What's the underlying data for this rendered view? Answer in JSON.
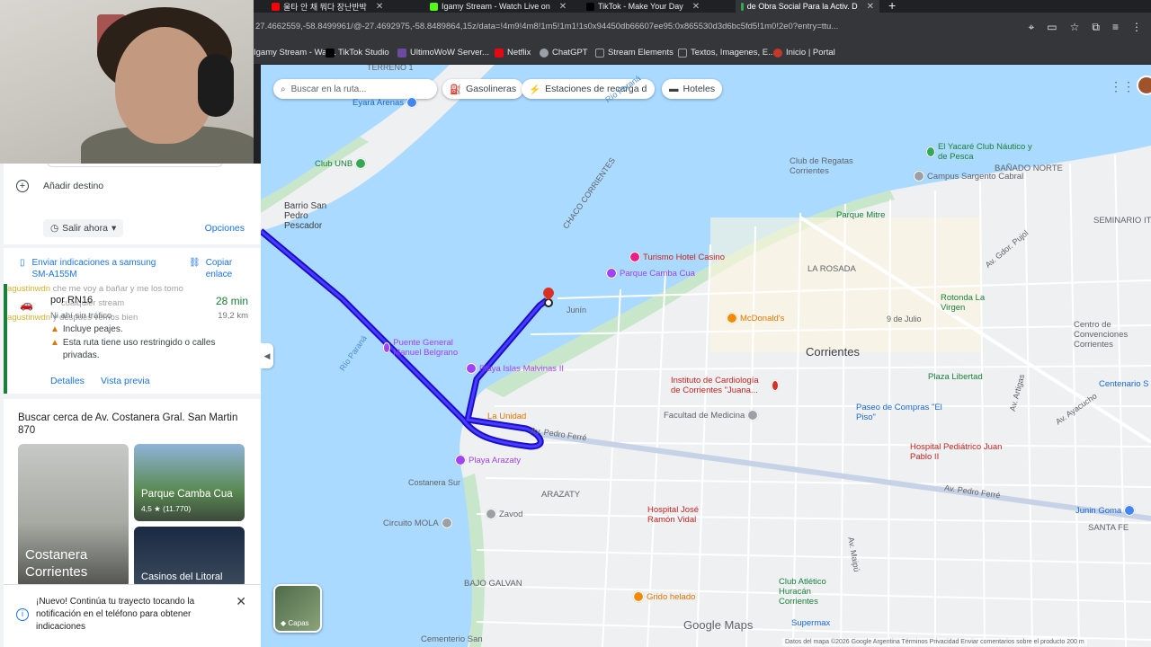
{
  "browser": {
    "tabs": [
      {
        "label": "울타 안 채 뭐다 장난반박",
        "color": "#ff0000"
      },
      {
        "label": "Igamy Stream - Watch Live on",
        "color": "#53fc18"
      },
      {
        "label": "TikTok - Make Your Day",
        "color": "#000000"
      },
      {
        "label": "de Obra Social Para la Activ. D",
        "color": "#34a853"
      }
    ],
    "url": "27.4662559,-58.8499961/@-27.4692975,-58.8489864,15z/data=!4m9!4m8!1m5!1m1!1s0x94450db66607ee95:0x865530d3d6bc5fd5!1m0!2e0?entry=ttu...",
    "bookmarks": [
      {
        "label": "Igamy Stream - Wat...",
        "color": "#53fc18"
      },
      {
        "label": "TikTok Studio",
        "color": "#000000"
      },
      {
        "label": "UltimoWoW Server...",
        "color": "#6b4aa0"
      },
      {
        "label": "Netflix",
        "color": "#e50914"
      },
      {
        "label": "ChatGPT",
        "color": "#9aa0a6"
      },
      {
        "label": "Stream Elements",
        "color": "#9aa0a6"
      },
      {
        "label": "Textos, Imagenes, E...",
        "color": "#9aa0a6"
      },
      {
        "label": "Inicio | Portal",
        "color": "#c0392b"
      }
    ]
  },
  "panel": {
    "add_destination": "Añadir destino",
    "depart": "Salir ahora",
    "options": "Opciones",
    "send": "Enviar indicaciones a samsung SM-A155M",
    "copy": "Copiar enlace",
    "route": {
      "via": "por RN16",
      "duration": "28 min",
      "traffic": "Ni ahí sin tráfico",
      "distance": "19,2 km",
      "warning1": "Incluye peajes.",
      "warning2": "Esta ruta tiene uso restringido o calles privadas.",
      "details": "Detalles",
      "preview": "Vista previa"
    },
    "chat": [
      {
        "user": "agustinwdn",
        "msg": "che me voy a bañar y me los tomo"
      },
      {
        "user": "",
        "msg": "cualquier stream"
      },
      {
        "user": "agustinwdn",
        "msg": "y después vemos bien"
      }
    ],
    "nearby_title": "Buscar cerca de Av. Costanera Gral. San Martin 870",
    "places": [
      {
        "name": "Costanera Corrientes"
      },
      {
        "name": "Parque Camba Cua",
        "rating": "4,5 ★ (11.770)"
      },
      {
        "name": "Casinos del Litoral"
      }
    ],
    "toast": "¡Nuevo! Continúa tu trayecto tocando la notificación en el teléfono para obtener indicaciones"
  },
  "map": {
    "search_placeholder": "Buscar en la ruta...",
    "chips": [
      "Gasolineras",
      "Estaciones de recarga d...",
      "Hoteles"
    ],
    "city": "Corrientes",
    "layers": "Capas",
    "logo": "Google Maps",
    "attribution": "Datos del mapa ©2026 Google   Argentina   Términos   Privacidad   Enviar comentarios sobre el producto   200 m",
    "labels": {
      "barrio": "Barrio San Pedro Pescador",
      "chaco": "CHACO CORRIENTES",
      "rio": "Río Paraná",
      "rio2": "Río Paraná",
      "la_rosada": "LA ROSADA",
      "banado": "BAÑADO NORTE",
      "seminario": "SEMINARIO ITA",
      "arazaty": "ARAZATY",
      "bajo_galvan": "BAJO GALVAN",
      "costanera_sur": "Costanera Sur",
      "terreno": "TERRENO 1",
      "lineas": "Av. Pedro Ferré",
      "av_ferre2": "Av. Pedro Ferré",
      "av_ayacucho": "Av. Ayacucho",
      "av_maipu": "Av. Maipú",
      "nueve_julio": "9 de Julio",
      "junin": "Junín",
      "santa_fe": "SANTA FE",
      "av_artigas": "Av. Artigas",
      "av_gdor": "Av. Gdor. Pujol"
    },
    "pois": [
      {
        "name": "Eyará Arenas",
        "color": "#4285f4"
      },
      {
        "name": "Club de Regatas Corrientes",
        "color": "#9aa0a6"
      },
      {
        "name": "El Yacaré Club Náutico y de Pesca",
        "color": "#34a853"
      },
      {
        "name": "Campus Sargento Cabral",
        "color": "#9aa0a6"
      },
      {
        "name": "Parque Mitre",
        "color": "#34a853"
      },
      {
        "name": "Turismo Hotel Casino",
        "color": "#e91e8c"
      },
      {
        "name": "Parque Camba Cua",
        "color": "#a142f4"
      },
      {
        "name": "McDonald's",
        "color": "#f28b00"
      },
      {
        "name": "Puente General Manuel Belgrano",
        "color": "#a142f4"
      },
      {
        "name": "Playa Islas Malvinas II",
        "color": "#a142f4"
      },
      {
        "name": "Instituto de Cardiología de Corrientes \"Juana...",
        "color": "#d93025"
      },
      {
        "name": "Facultad de Medicina",
        "color": "#9aa0a6"
      },
      {
        "name": "Paseo de Compras \"El Piso\"",
        "color": "#4285f4"
      },
      {
        "name": "Plaza Libertad",
        "color": "#34a853"
      },
      {
        "name": "Hospital Pediátrico Juan Pablo II",
        "color": "#d93025"
      },
      {
        "name": "La Unidad",
        "color": "#f28b00"
      },
      {
        "name": "Playa Arazaty",
        "color": "#a142f4"
      },
      {
        "name": "Hospital José Ramón Vidal",
        "color": "#d93025"
      },
      {
        "name": "Circuito MOLA",
        "color": "#9aa0a6"
      },
      {
        "name": "Zavod",
        "color": "#9aa0a6"
      },
      {
        "name": "Grido helado",
        "color": "#f28b00"
      },
      {
        "name": "Club Atlético Huracán Corrientes",
        "color": "#34a853"
      },
      {
        "name": "Supermax",
        "color": "#4285f4"
      },
      {
        "name": "Club UNB",
        "color": "#34a853"
      },
      {
        "name": "Rotonda La Virgen",
        "color": "#34a853"
      },
      {
        "name": "Centro de Convenciones Corrientes",
        "color": "#9aa0a6"
      },
      {
        "name": "Centenario S",
        "color": "#4285f4"
      },
      {
        "name": "Cementerio San",
        "color": "#9aa0a6"
      },
      {
        "name": "Rio Paraná",
        "color": "#9aa0a6"
      },
      {
        "name": "Junin Goma",
        "color": "#4285f4"
      }
    ]
  }
}
